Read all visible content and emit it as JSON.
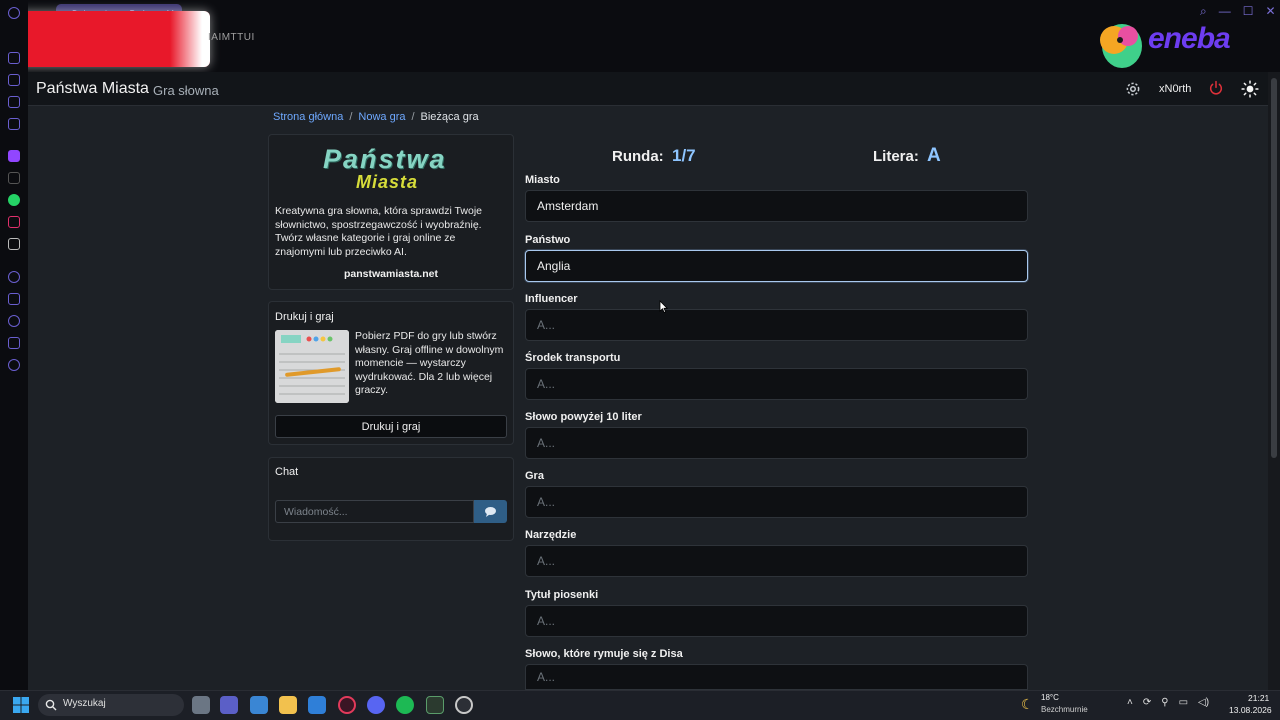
{
  "browser": {
    "tab_title": "Dołącz do gry Państwa M...",
    "address_text": "IAIMTTUI"
  },
  "eneba": {
    "brand": "eneba"
  },
  "navbar": {
    "title": "Państwa Miasta",
    "subtitle": "Gra słowna",
    "username": "xN0rth"
  },
  "breadcrumb": {
    "home": "Strona główna",
    "new_game": "Nowa gra",
    "current": "Bieżąca gra"
  },
  "intro": {
    "logo_main": "Państwa",
    "logo_sub": "Miasta",
    "text": "Kreatywna gra słowna, która sprawdzi Twoje słownictwo, spostrzegawczość i wyobraźnię. Twórz własne kategorie i graj online ze znajomymi lub przeciwko AI.",
    "site": "panstwamiasta.net"
  },
  "print": {
    "title": "Drukuj i graj",
    "text": "Pobierz PDF do gry lub stwórz własny. Graj offline w dowolnym momencie — wystarczy wydrukować. Dla 2 lub więcej graczy.",
    "button": "Drukuj i graj"
  },
  "chat": {
    "title": "Chat",
    "placeholder": "Wiadomość..."
  },
  "game": {
    "round_label": "Runda:",
    "round_value": "1/7",
    "letter_label": "Litera:",
    "letter_value": "A",
    "fields": [
      {
        "label": "Miasto",
        "value": "Amsterdam",
        "placeholder": "A..."
      },
      {
        "label": "Państwo",
        "value": "Anglia",
        "placeholder": "A..."
      },
      {
        "label": "Influencer",
        "value": "",
        "placeholder": "A..."
      },
      {
        "label": "Środek transportu",
        "value": "",
        "placeholder": "A..."
      },
      {
        "label": "Słowo powyżej 10 liter",
        "value": "",
        "placeholder": "A..."
      },
      {
        "label": "Gra",
        "value": "",
        "placeholder": "A..."
      },
      {
        "label": "Narzędzie",
        "value": "",
        "placeholder": "A..."
      },
      {
        "label": "Tytuł piosenki",
        "value": "",
        "placeholder": "A..."
      },
      {
        "label": "Słowo, które rymuje się z Disa",
        "value": "",
        "placeholder": "A..."
      }
    ]
  },
  "taskbar": {
    "search_text": "Wyszukaj",
    "weather_temp": "18°C",
    "weather_desc": "Bezchmurnie",
    "time": "21:21",
    "date": "13.08.2026"
  },
  "colors": {
    "accent_link": "#6ea8fe",
    "round_value": "#8ec5ff",
    "send_button": "#2f5e86",
    "power": "#e0313a"
  }
}
